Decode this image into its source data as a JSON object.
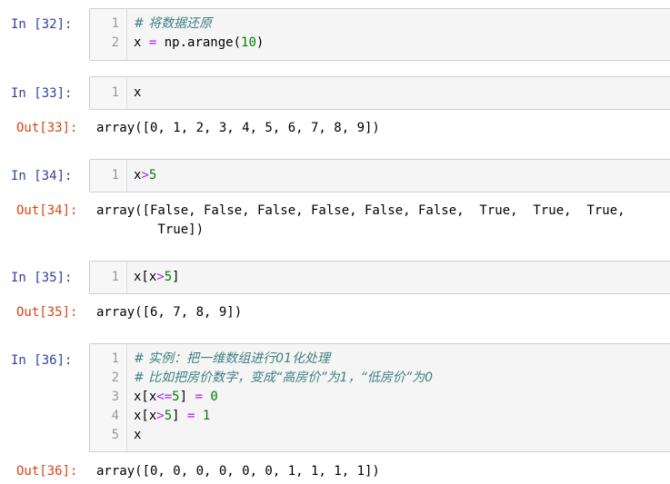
{
  "cells": [
    {
      "in_label": "In  [32]:",
      "lines": [
        "1",
        "2"
      ],
      "code": [
        {
          "comment": "# 将数据还原"
        },
        {
          "pre": "x ",
          "op": "=",
          "post": " np.arange(",
          "num": "10",
          "tail": ")"
        }
      ]
    },
    {
      "in_label": "In  [33]:",
      "lines": [
        "1"
      ],
      "code": [
        {
          "text": "x"
        }
      ],
      "out_label": "Out[33]:",
      "output": [
        "array([0, 1, 2, 3, 4, 5, 6, 7, 8, 9])"
      ]
    },
    {
      "in_label": "In  [34]:",
      "lines": [
        "1"
      ],
      "code": [
        {
          "pre": "x",
          "op": ">",
          "num": "5"
        }
      ],
      "out_label": "Out[34]:",
      "output": [
        "array([False, False, False, False, False, False,  True,  True,  True,",
        "        True])"
      ]
    },
    {
      "in_label": "In  [35]:",
      "lines": [
        "1"
      ],
      "code": [
        {
          "pre": "x[x",
          "op": ">",
          "num": "5",
          "tail": "]"
        }
      ],
      "out_label": "Out[35]:",
      "output": [
        "array([6, 7, 8, 9])"
      ]
    },
    {
      "in_label": "In  [36]:",
      "lines": [
        "1",
        "2",
        "3",
        "4",
        "5"
      ],
      "code": [
        {
          "comment": "# 实例：把一维数组进行01化处理"
        },
        {
          "comment": "# 比如把房价数字，变成“高房价”为1，“低房价”为0"
        },
        {
          "pre": "x[x",
          "op": "<=",
          "num": "5",
          "tail": "] ",
          "op2": "=",
          "num2": " 0"
        },
        {
          "pre": "x[x",
          "op": ">",
          "num": "5",
          "tail": "] ",
          "op2": "=",
          "num2": " 1"
        },
        {
          "text": "x"
        }
      ],
      "out_label": "Out[36]:",
      "output": [
        "array([0, 0, 0, 0, 0, 0, 1, 1, 1, 1])"
      ]
    }
  ]
}
